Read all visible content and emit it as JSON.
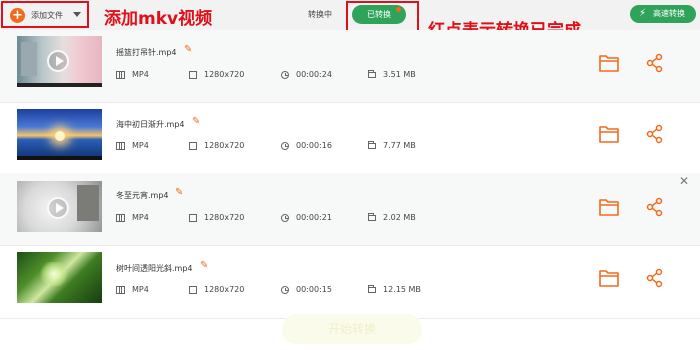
{
  "toolbar": {
    "add_label": "添加文件",
    "converting_tab": "转换中",
    "done_tab": "已转换",
    "turbo_label": "高速转换",
    "accent": "#f26b1d",
    "green": "#2fa35a"
  },
  "annotations": {
    "add_note": "添加mkv视频",
    "done_note": "红点表示转换已完成",
    "color": "#e0101a"
  },
  "files": [
    {
      "name": "摇篮打吊针.mp4",
      "format": "MP4",
      "resolution": "1280x720",
      "duration": "00:00:24",
      "size": "3.51 MB",
      "thumb": "room"
    },
    {
      "name": "海中初日渐升.mp4",
      "format": "MP4",
      "resolution": "1280x720",
      "duration": "00:00:16",
      "size": "7.77 MB",
      "thumb": "sunrise"
    },
    {
      "name": "冬至元宵.mp4",
      "format": "MP4",
      "resolution": "1280x720",
      "duration": "00:00:21",
      "size": "2.02 MB",
      "thumb": "dumplings"
    },
    {
      "name": "树叶间透阳光斜.mp4",
      "format": "MP4",
      "resolution": "1280x720",
      "duration": "00:00:15",
      "size": "12.15 MB",
      "thumb": "leaves"
    }
  ],
  "icons": {
    "plus": "plus-icon",
    "caret": "chevron-down-icon",
    "bolt": "lightning-icon",
    "edit": "pencil-icon",
    "film": "film-icon",
    "resolution": "expand-icon",
    "clock": "clock-icon",
    "folder": "folder-icon",
    "share": "share-icon",
    "close": "close-icon"
  },
  "ghost_text": "开始转换"
}
